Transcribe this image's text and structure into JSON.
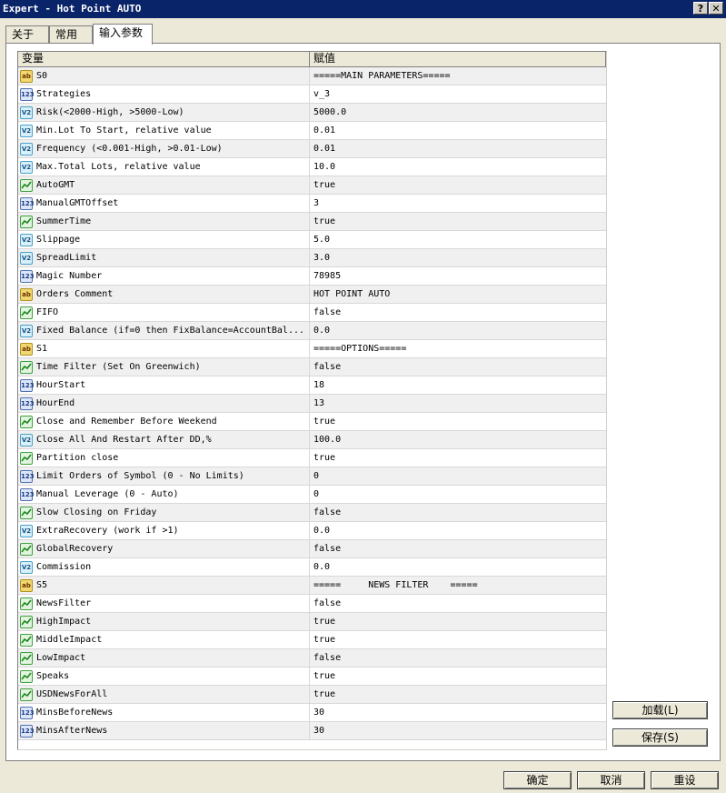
{
  "window": {
    "title": "Expert - Hot Point AUTO",
    "help_label": "?",
    "close_label": "✕"
  },
  "tabs": [
    {
      "label": "关于"
    },
    {
      "label": "常用"
    },
    {
      "label": "输入参数"
    }
  ],
  "grid": {
    "headers": {
      "variable": "变量",
      "value": "赋值"
    },
    "rows": [
      {
        "type": "str",
        "name": "S0",
        "value": "=====MAIN PARAMETERS====="
      },
      {
        "type": "int",
        "name": "Strategies",
        "value": "v_3"
      },
      {
        "type": "dbl",
        "name": "Risk(<2000-High, >5000-Low)",
        "value": "5000.0"
      },
      {
        "type": "dbl",
        "name": "Min.Lot To Start, relative value",
        "value": "0.01"
      },
      {
        "type": "dbl",
        "name": "Frequency (<0.001-High, >0.01-Low)",
        "value": "0.01"
      },
      {
        "type": "dbl",
        "name": "Max.Total Lots, relative value",
        "value": "10.0"
      },
      {
        "type": "bool",
        "name": "AutoGMT",
        "value": "true"
      },
      {
        "type": "int",
        "name": "ManualGMTOffset",
        "value": "3"
      },
      {
        "type": "bool",
        "name": "SummerTime",
        "value": "true"
      },
      {
        "type": "dbl",
        "name": "Slippage",
        "value": "5.0"
      },
      {
        "type": "dbl",
        "name": "SpreadLimit",
        "value": "3.0"
      },
      {
        "type": "int",
        "name": "Magic Number",
        "value": "78985"
      },
      {
        "type": "str",
        "name": "Orders Comment",
        "value": "HOT POINT AUTO"
      },
      {
        "type": "bool",
        "name": "FIFO",
        "value": "false"
      },
      {
        "type": "dbl",
        "name": "Fixed Balance (if=0 then FixBalance=AccountBal...",
        "value": "0.0"
      },
      {
        "type": "str",
        "name": "S1",
        "value": "=====OPTIONS====="
      },
      {
        "type": "bool",
        "name": "Time Filter (Set On Greenwich)",
        "value": "false"
      },
      {
        "type": "int",
        "name": "HourStart",
        "value": "18"
      },
      {
        "type": "int",
        "name": "HourEnd",
        "value": "13"
      },
      {
        "type": "bool",
        "name": "Close and Remember Before Weekend",
        "value": "true"
      },
      {
        "type": "dbl",
        "name": "Close All And Restart After DD,%",
        "value": "100.0"
      },
      {
        "type": "bool",
        "name": "Partition close",
        "value": "true"
      },
      {
        "type": "int",
        "name": "Limit Orders of Symbol (0 - No Limits)",
        "value": "0"
      },
      {
        "type": "int",
        "name": "Manual Leverage (0 - Auto)",
        "value": "0"
      },
      {
        "type": "bool",
        "name": "Slow Closing on Friday",
        "value": "false"
      },
      {
        "type": "dbl",
        "name": "ExtraRecovery (work if >1)",
        "value": "0.0"
      },
      {
        "type": "bool",
        "name": "GlobalRecovery",
        "value": "false"
      },
      {
        "type": "dbl",
        "name": "Commission",
        "value": "0.0"
      },
      {
        "type": "str",
        "name": "S5",
        "value": "=====     NEWS FILTER    ====="
      },
      {
        "type": "bool",
        "name": "NewsFilter",
        "value": "false"
      },
      {
        "type": "bool",
        "name": "HighImpact",
        "value": "true"
      },
      {
        "type": "bool",
        "name": "MiddleImpact",
        "value": "true"
      },
      {
        "type": "bool",
        "name": "LowImpact",
        "value": "false"
      },
      {
        "type": "bool",
        "name": "Speaks",
        "value": "true"
      },
      {
        "type": "bool",
        "name": "USDNewsForAll",
        "value": "true"
      },
      {
        "type": "int",
        "name": "MinsBeforeNews",
        "value": "30"
      },
      {
        "type": "int",
        "name": "MinsAfterNews",
        "value": "30"
      }
    ]
  },
  "icons": {
    "str": "ab",
    "int": "123",
    "dbl": "V2",
    "bool": ""
  },
  "buttons": {
    "load": "加载(L)",
    "save": "保存(S)",
    "ok": "确定",
    "cancel": "取消",
    "reset": "重设"
  }
}
